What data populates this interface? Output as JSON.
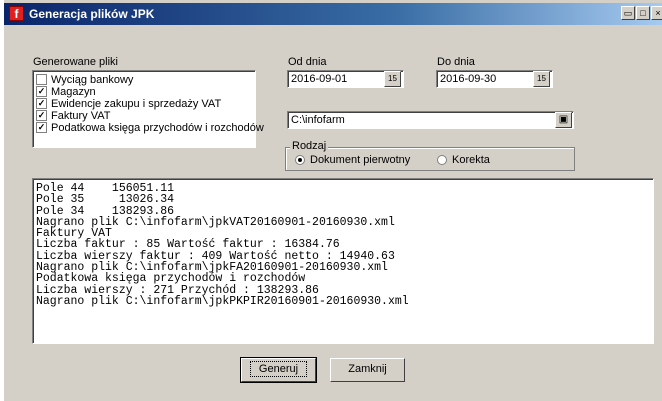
{
  "window": {
    "title": "Generacja plików JPK",
    "app_icon": "jpk-app-icon"
  },
  "files": {
    "label": "Generowane pliki",
    "items": [
      {
        "label": "Wyciąg bankowy",
        "checked": false
      },
      {
        "label": "Magazyn",
        "checked": true
      },
      {
        "label": "Ewidencje zakupu i sprzedaży VAT",
        "checked": true
      },
      {
        "label": "Faktury VAT",
        "checked": true
      },
      {
        "label": "Podatkowa księga przychodów i rozchodów",
        "checked": true
      }
    ]
  },
  "date_from": {
    "label": "Od dnia",
    "value": "2016-09-01",
    "button": "15"
  },
  "date_to": {
    "label": "Do dnia",
    "value": "2016-09-30",
    "button": "15"
  },
  "path": {
    "value": "C:\\infofarm"
  },
  "rodzaj": {
    "label": "Rodzaj",
    "options": [
      {
        "label": "Dokument pierwotny",
        "selected": true
      },
      {
        "label": "Korekta",
        "selected": false
      }
    ]
  },
  "log_lines": [
    "Pole 44    156051.11",
    "Pole 35     13026.34",
    "Pole 34    138293.86",
    "Nagrano plik C:\\infofarm\\jpkVAT20160901-20160930.xml",
    "Faktury VAT",
    "Liczba faktur : 85 Wartość faktur : 16384.76",
    "Liczba wierszy faktur : 409 Wartość netto : 14940.63",
    "Nagrano plik C:\\infofarm\\jpkFA20160901-20160930.xml",
    "Podatkowa księga przychodów i rozchodów",
    "Liczba wierszy : 271 Przychód : 138293.86",
    "Nagrano plik C:\\infofarm\\jpkPKPIR20160901-20160930.xml"
  ],
  "buttons": {
    "generate": "Generuj",
    "close": "Zamknij"
  }
}
